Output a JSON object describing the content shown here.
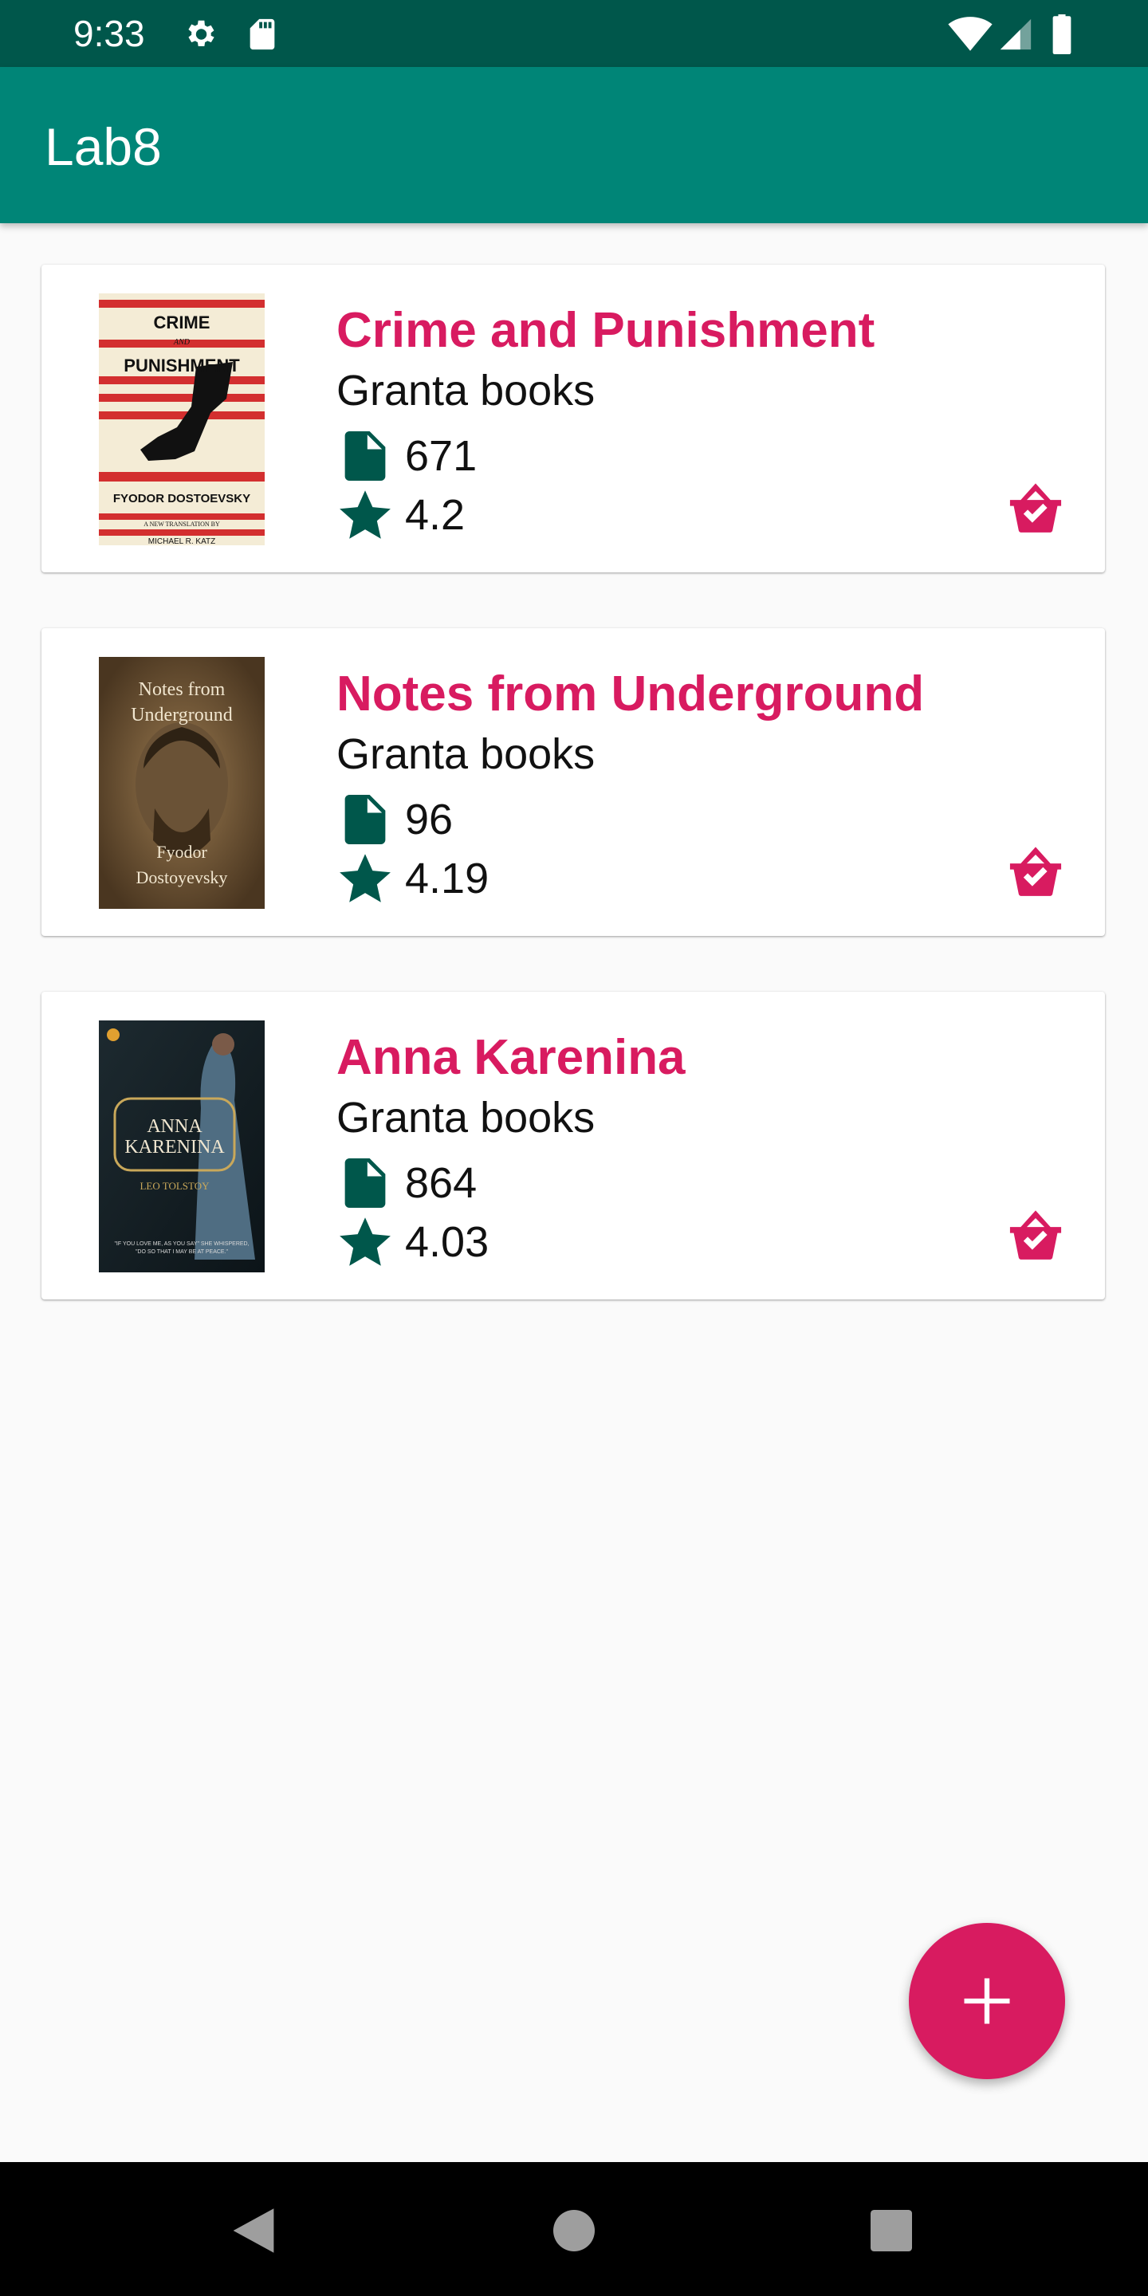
{
  "status_bar": {
    "time": "9:33"
  },
  "app_bar": {
    "title": "Lab8"
  },
  "colors": {
    "accent": "#d81b60",
    "primary": "#008577",
    "primary_dark": "#00574b",
    "icon_green": "#00574b"
  },
  "books": [
    {
      "title": "Crime and Punishment",
      "publisher": "Granta books",
      "pages": "671",
      "rating": "4.2",
      "cover": {
        "l1": "CRIME",
        "l2": "AND",
        "l3": "PUNISHMENT",
        "author": "FYODOR DOSTOEVSKY",
        "note": "A NEW TRANSLATION BY",
        "translator": "MICHAEL R. KATZ"
      }
    },
    {
      "title": "Notes from Underground",
      "publisher": "Granta books",
      "pages": "96",
      "rating": "4.19",
      "cover": {
        "l1": "Notes from",
        "l2": "Underground",
        "a1": "Fyodor",
        "a2": "Dostoyevsky"
      }
    },
    {
      "title": "Anna Karenina",
      "publisher": "Granta books",
      "pages": "864",
      "rating": "4.03",
      "cover": {
        "l1": "ANNA",
        "l2": "KARENINA",
        "author": "LEO TOLSTOY",
        "quote1": "\"IF YOU LOVE ME, AS YOU SAY\" SHE WHISPERED,",
        "quote2": "\"DO SO THAT I MAY BE AT PEACE.\""
      }
    }
  ],
  "icons": {
    "pages": "file-icon",
    "rating": "star-icon",
    "basket": "basket-check-icon",
    "fab": "plus-icon"
  }
}
